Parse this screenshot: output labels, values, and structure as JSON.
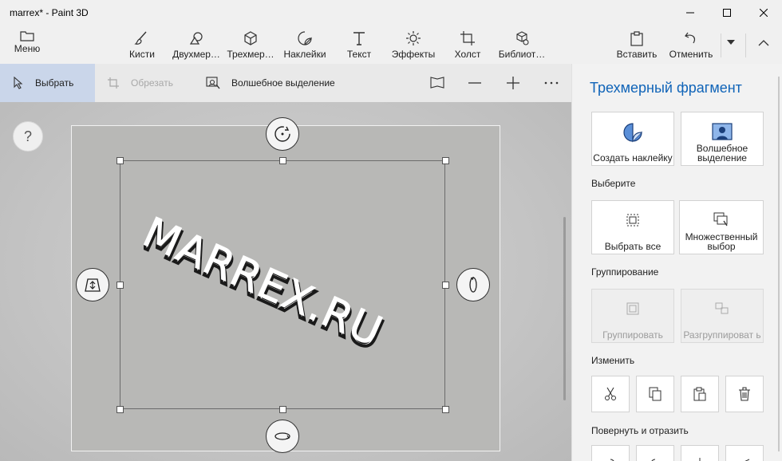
{
  "window": {
    "title": "marrex* - Paint 3D"
  },
  "ribbon": {
    "menu": "Меню",
    "tools": [
      {
        "id": "brushes",
        "label": "Кисти"
      },
      {
        "id": "2d",
        "label": "Двухмер…"
      },
      {
        "id": "3d",
        "label": "Трехмер…"
      },
      {
        "id": "stickers",
        "label": "Наклейки"
      },
      {
        "id": "text",
        "label": "Текст"
      },
      {
        "id": "effects",
        "label": "Эффекты"
      },
      {
        "id": "canvas",
        "label": "Холст"
      },
      {
        "id": "library",
        "label": "Библиот…"
      }
    ],
    "paste": "Вставить",
    "undo": "Отменить"
  },
  "subtoolbar": {
    "select": "Выбрать",
    "crop": "Обрезать",
    "magic_select": "Волшебное выделение"
  },
  "canvas": {
    "help": "?",
    "artwork_text": "MARREX.RU"
  },
  "panel": {
    "title": "Трехмерный фрагмент",
    "create_sticker": "Создать наклейку",
    "magic_select": "Волшебное выделение",
    "section_select": "Выберите",
    "select_all": "Выбрать все",
    "multi_select": "Множественный выбор",
    "section_group": "Группирование",
    "group": "Группировать",
    "ungroup": "Разгруппироват ь",
    "section_edit": "Изменить",
    "section_rotate": "Повернуть и отразить"
  },
  "colors": {
    "accent": "#1064b8",
    "selection_bg": "#cad6ea"
  }
}
